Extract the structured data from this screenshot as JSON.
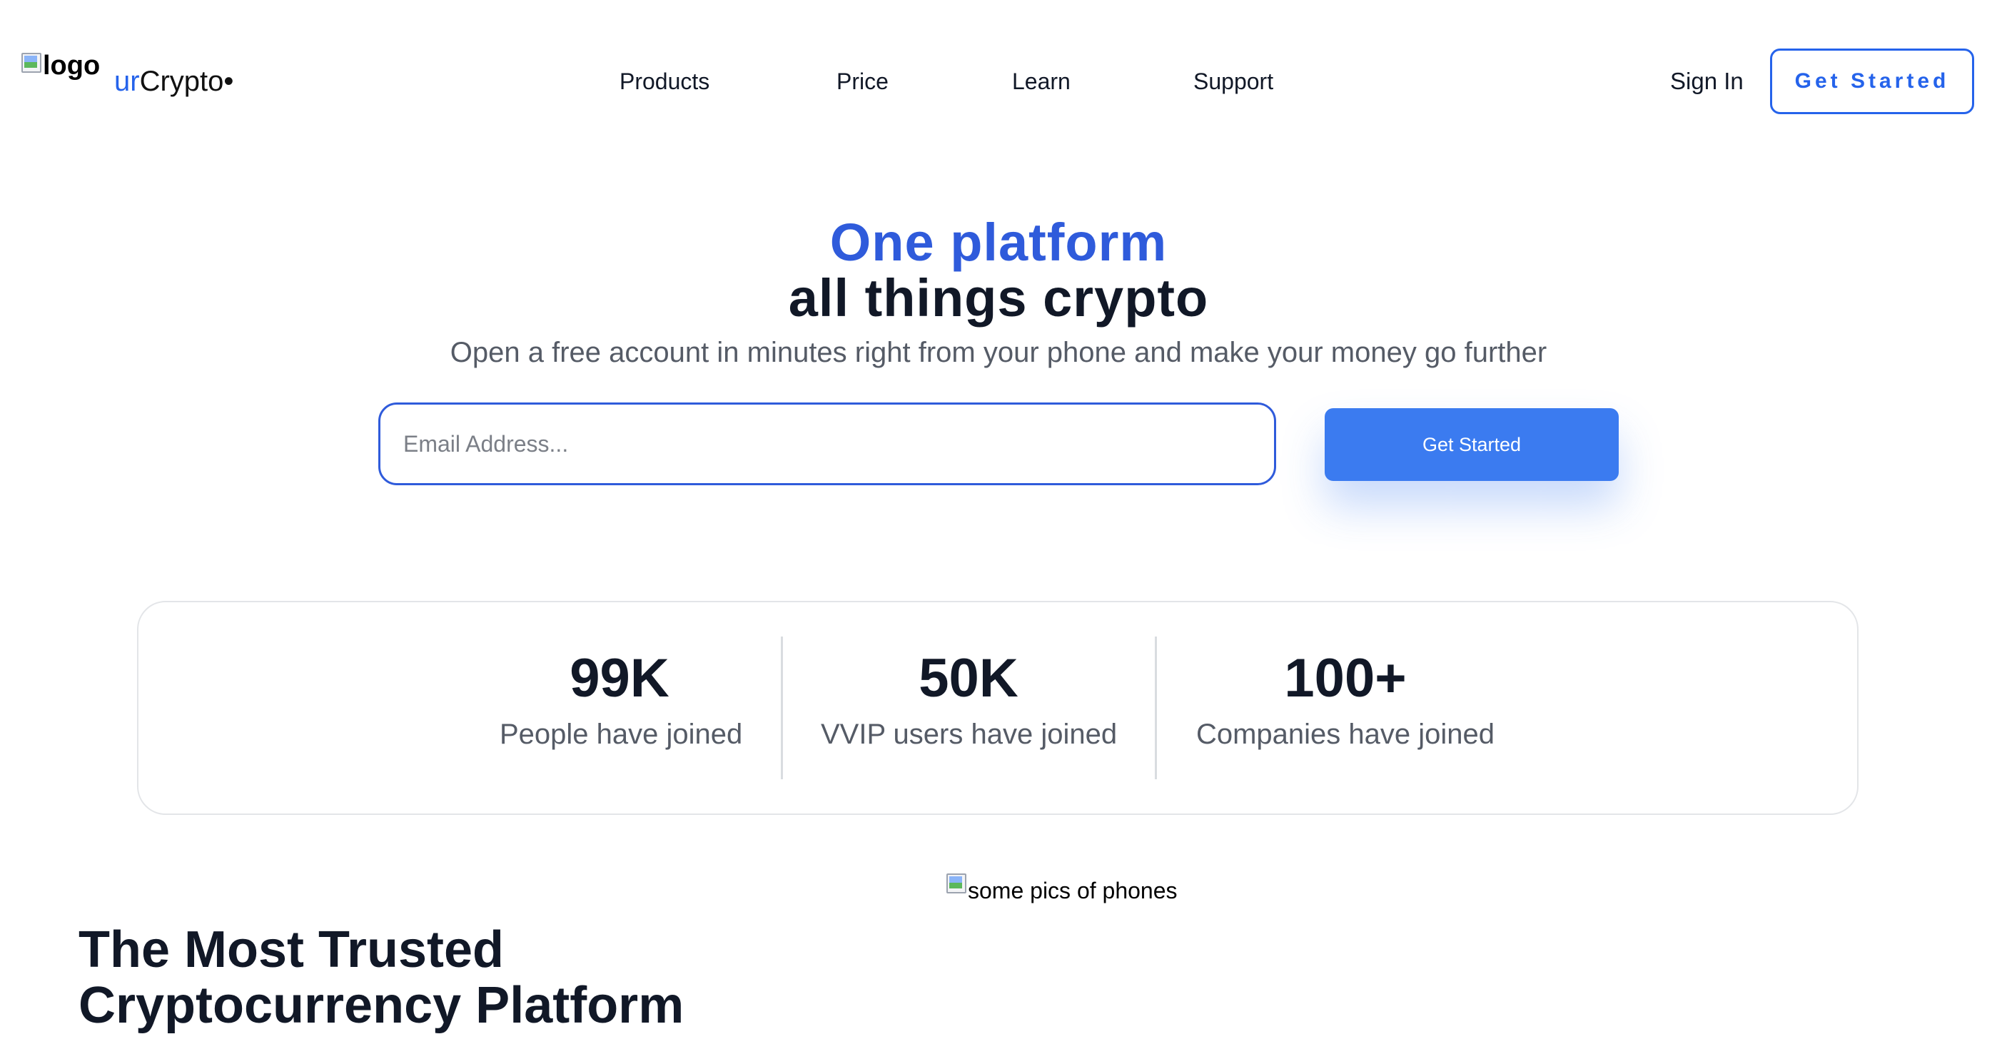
{
  "header": {
    "logo_alt": "logo",
    "brand_prefix": "ur",
    "brand_rest": "Crypto•",
    "nav": [
      "Products",
      "Price",
      "Learn",
      "Support"
    ],
    "sign_in": "Sign In",
    "cta": "Get Started"
  },
  "hero": {
    "title_line1": "One platform",
    "title_line2": "all things crypto",
    "subtitle": "Open a free account in minutes right from your phone and make your money go further",
    "email_placeholder": "Email Address...",
    "cta": "Get Started"
  },
  "stats": [
    {
      "value": "99K",
      "label": "People have joined"
    },
    {
      "value": "50K",
      "label": "VVIP users have joined"
    },
    {
      "value": "100+",
      "label": "Companies have joined"
    }
  ],
  "section": {
    "phones_alt": "some pics of phones",
    "title_line1": "The Most Trusted",
    "title_line2": "Cryptocurrency Platform"
  },
  "colors": {
    "accent": "#2563eb",
    "button": "#3b7bf0",
    "heading": "#111827",
    "muted": "#555b66"
  }
}
